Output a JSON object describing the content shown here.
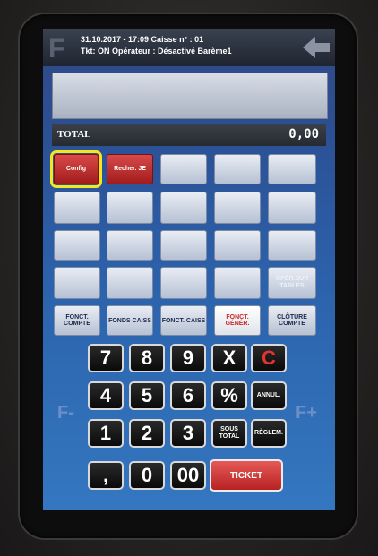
{
  "header": {
    "logo": "F",
    "line1": "31.10.2017 - 17:09   Caisse n° : 01",
    "line2": "Tkt: ON Opérateur : Désactivé   Barème1"
  },
  "total": {
    "label": "TOTAL",
    "value": "0,00"
  },
  "grid": {
    "config": "Config",
    "recherche": "Recher. JE",
    "oper_sur_tables": "OPÉR.SUR TABLES"
  },
  "functions": {
    "fonct_compte": "FONCT. COMPTE",
    "fonds_caiss": "FONDS CAISS",
    "fonct_caiss": "FONCT. CAISS",
    "fonct_gener": "FONCT. GÉNÉR.",
    "cloture_compte": "CLÔTURE COMPTE"
  },
  "keypad": {
    "k7": "7",
    "k8": "8",
    "k9": "9",
    "x": "X",
    "c": "C",
    "k4": "4",
    "k5": "5",
    "k6": "6",
    "pct": "%",
    "annul": "ANNUL.",
    "k1": "1",
    "k2": "2",
    "k3": "3",
    "sous_total": "SOUS TOTAL",
    "reglem": "RÈGLEM.",
    "comma": ",",
    "k0": "0",
    "k00": "00",
    "ticket": "TICKET"
  },
  "side": {
    "f_minus": "F-",
    "f_plus": "F+"
  },
  "colors": {
    "accent_red": "#b82222",
    "highlight": "#f5e81a",
    "screen_blue": "#2c63ad"
  }
}
